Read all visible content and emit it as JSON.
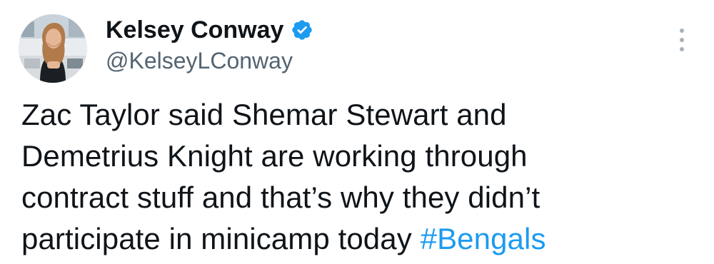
{
  "author": {
    "display_name": "Kelsey Conway",
    "handle": "@KelseyLConway",
    "verified_icon": "verified-badge-icon",
    "verified_color": "#1d9bf0"
  },
  "more_menu_icon": "more-vertical-icon",
  "tweet": {
    "lines": [
      "Zac Taylor said Shemar Stewart and",
      "Demetrius Knight are working through",
      "contract stuff and that’s why they didn’t",
      "participate in minicamp today "
    ],
    "hashtag": "#Bengals",
    "hashtag_color": "#1d9bf0",
    "text_color": "#0f1419"
  }
}
